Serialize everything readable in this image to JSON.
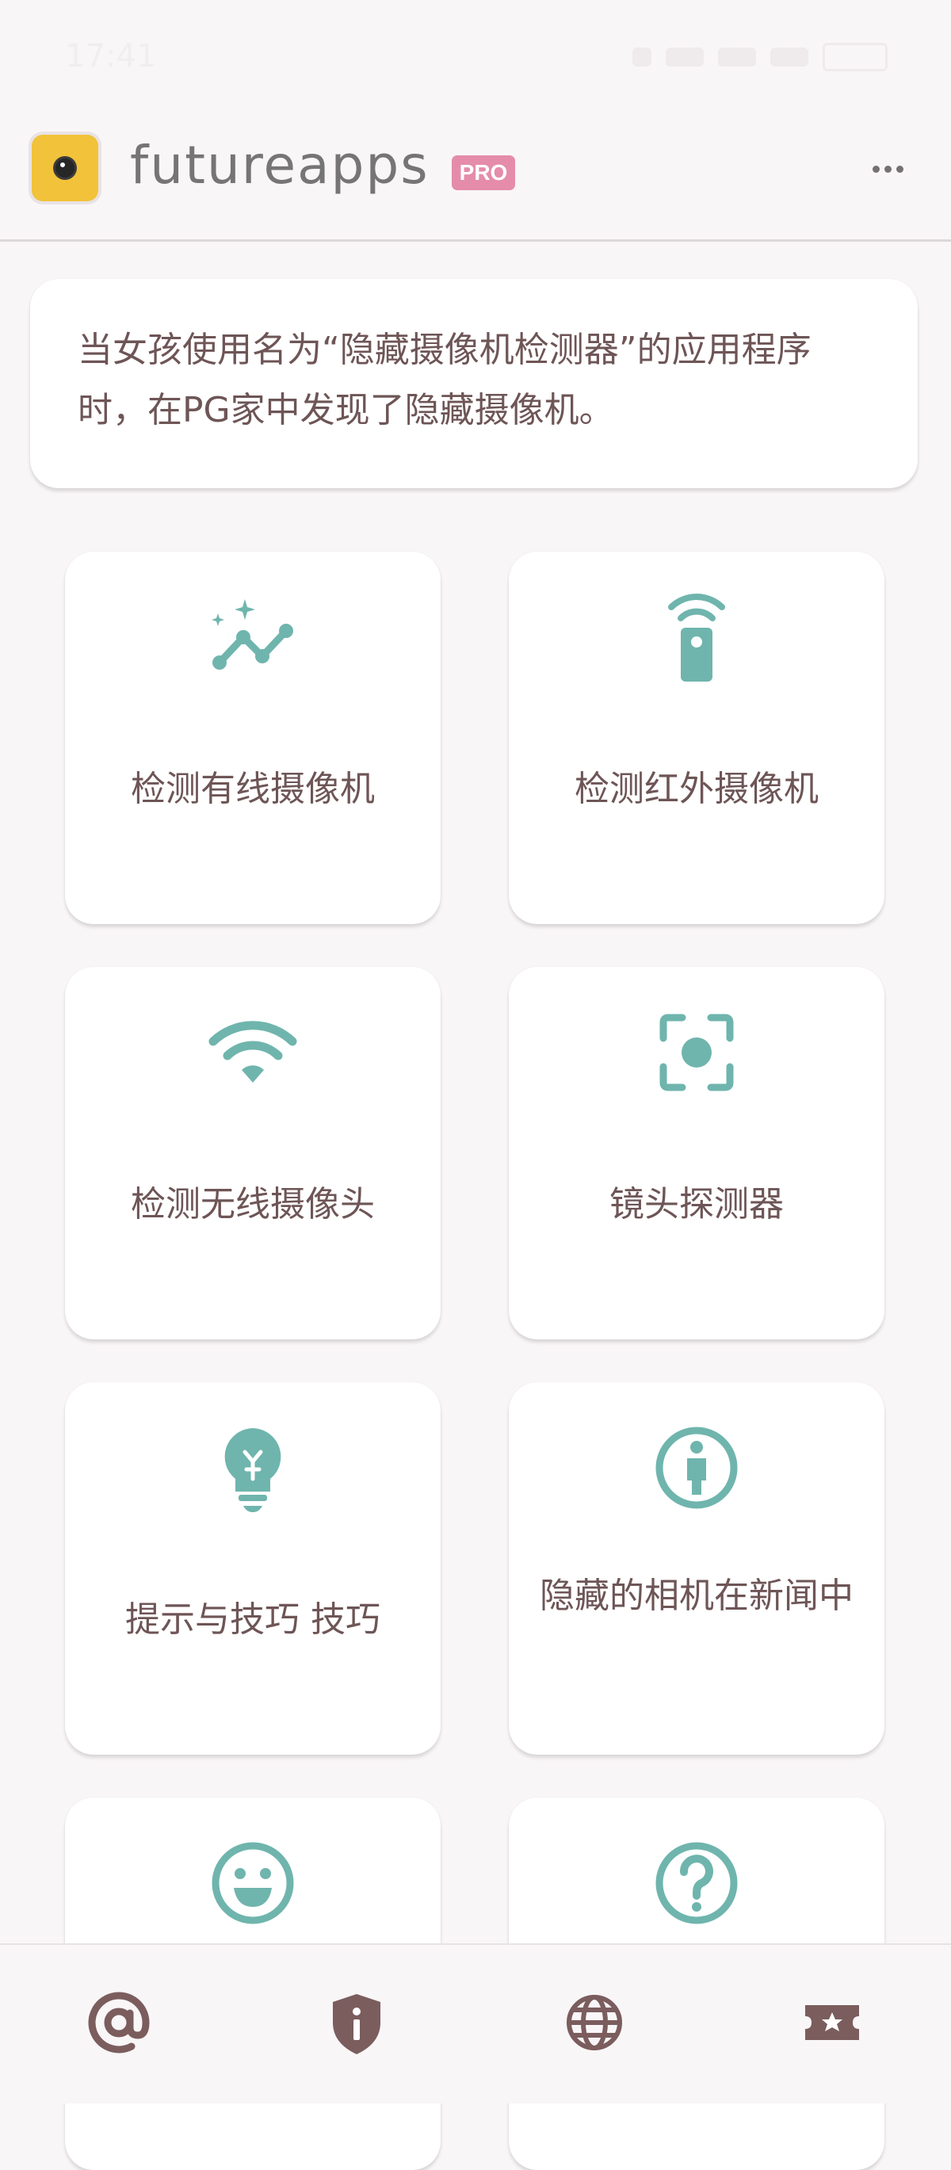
{
  "status_bar": {
    "time": "17:41"
  },
  "header": {
    "app_name": "futureapps",
    "badge": "PRO",
    "more_icon": "more-horizontal-icon"
  },
  "description": "当女孩使用名为“隐藏摄像机检测器”的应用程序时，在PG家中发现了隐藏摄像机。",
  "cards": [
    {
      "label": "检测有线摄像机",
      "icon": "sparkle-trend-icon"
    },
    {
      "label": "检测红外摄像机",
      "icon": "infrared-remote-icon"
    },
    {
      "label": "检测无线摄像头",
      "icon": "wifi-icon"
    },
    {
      "label": "镜头探测器",
      "icon": "focus-target-icon"
    },
    {
      "label": "提示与技巧 技巧",
      "icon": "lightbulb-icon"
    },
    {
      "label": "隐藏的相机在新闻中",
      "icon": "person-info-icon"
    },
    {
      "label": "",
      "icon": "smiley-icon"
    },
    {
      "label": "",
      "icon": "help-circle-icon"
    }
  ],
  "bottom_nav": [
    {
      "icon": "at-sign-icon"
    },
    {
      "icon": "shield-info-icon"
    },
    {
      "icon": "globe-icon"
    },
    {
      "icon": "ticket-star-icon"
    }
  ],
  "colors": {
    "accent": "#6fb5ad",
    "text": "#6e5556",
    "nav_icon": "#7b5d5e",
    "badge": "#e58cab",
    "logo": "#f2c23a",
    "background": "#f9f6f7"
  }
}
